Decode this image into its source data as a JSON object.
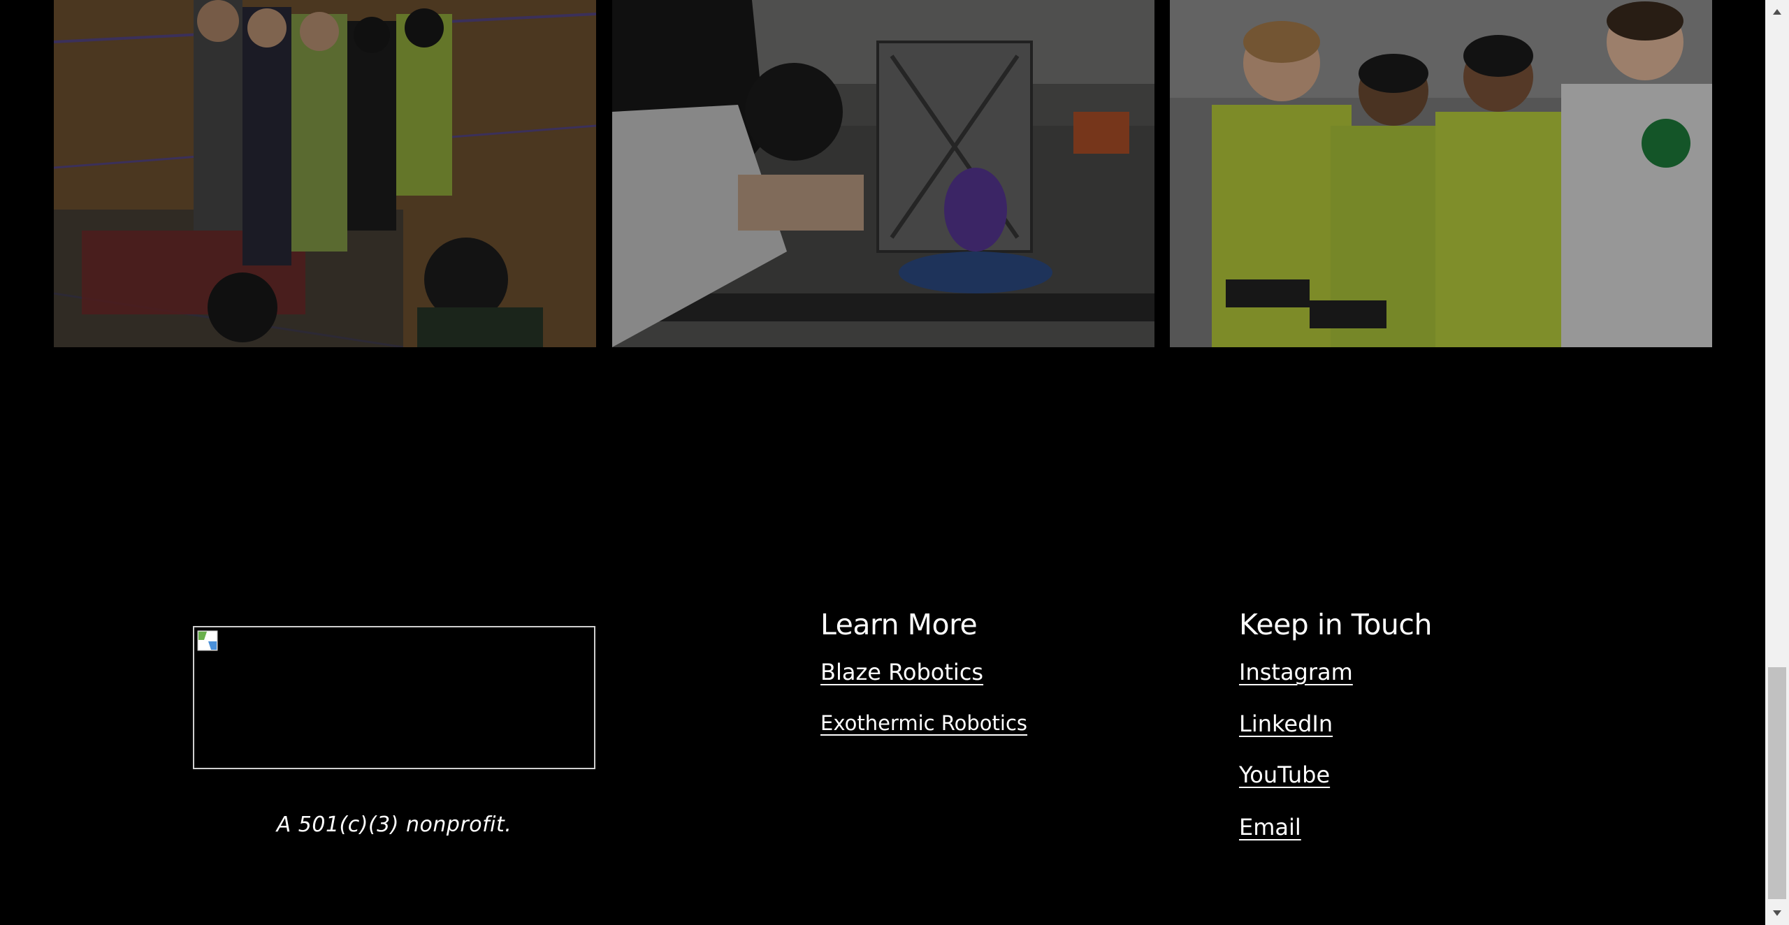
{
  "gallery": {
    "photos": [
      {
        "icon": "robotics-team-photo-icon"
      },
      {
        "icon": "robot-build-photo-icon"
      },
      {
        "icon": "drivers-competition-photo-icon"
      }
    ]
  },
  "footer": {
    "logo_icon": "broken-image-icon",
    "tagline": "A 501(c)(3) nonprofit.",
    "learn_more": {
      "heading": "Learn More",
      "links": [
        "Blaze Robotics",
        "Exothermic Robotics"
      ]
    },
    "keep_in_touch": {
      "heading": "Keep in Touch",
      "links": [
        "Instagram",
        "LinkedIn",
        "YouTube",
        "Email"
      ]
    }
  },
  "colors": {
    "background": "#000000",
    "text": "#ffffff",
    "scrollbar_track": "#f1f1f1",
    "scrollbar_thumb": "#c1c1c1"
  }
}
